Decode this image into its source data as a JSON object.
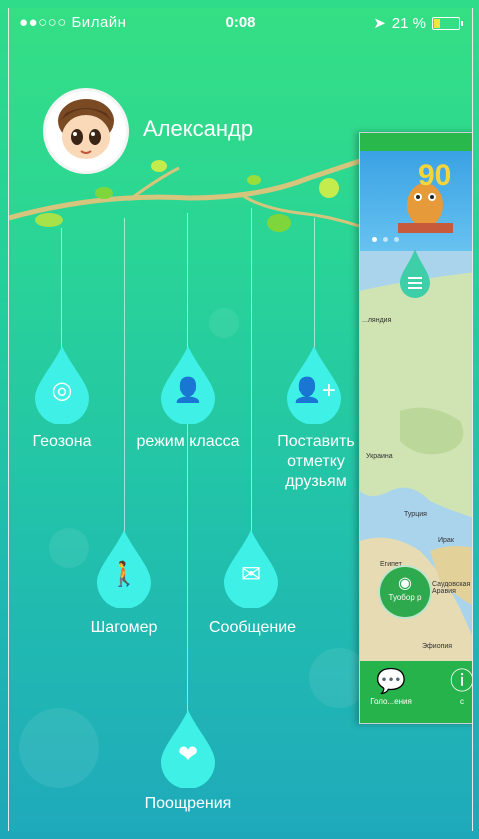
{
  "status": {
    "carrier": "●●○○○ Билайн",
    "time": "0:08",
    "battery": "21 %"
  },
  "profile": {
    "name": "Александр"
  },
  "menu": [
    {
      "label": "Геозона",
      "icon": "geofence-icon"
    },
    {
      "label": "режим класса",
      "icon": "class-mode-icon"
    },
    {
      "label": "Поставить отметку друзьям",
      "icon": "add-friend-icon"
    },
    {
      "label": "Шагомер",
      "icon": "pedometer-icon"
    },
    {
      "label": "Сообщение",
      "icon": "message-icon"
    },
    {
      "label": "Поощрения",
      "icon": "heart-icon"
    }
  ],
  "side_panel": {
    "banner_number": "90",
    "map_labels": [
      "...ляндия",
      "Украина",
      "Турция",
      "Ирак",
      "Египет",
      "Саудовская Аравия",
      "Эфиопия"
    ],
    "go_button_label": "Туобор р",
    "bottom": [
      {
        "label": "Голо...ения",
        "icon": "chat-icon"
      },
      {
        "label": "с",
        "icon": "info-icon"
      }
    ]
  }
}
